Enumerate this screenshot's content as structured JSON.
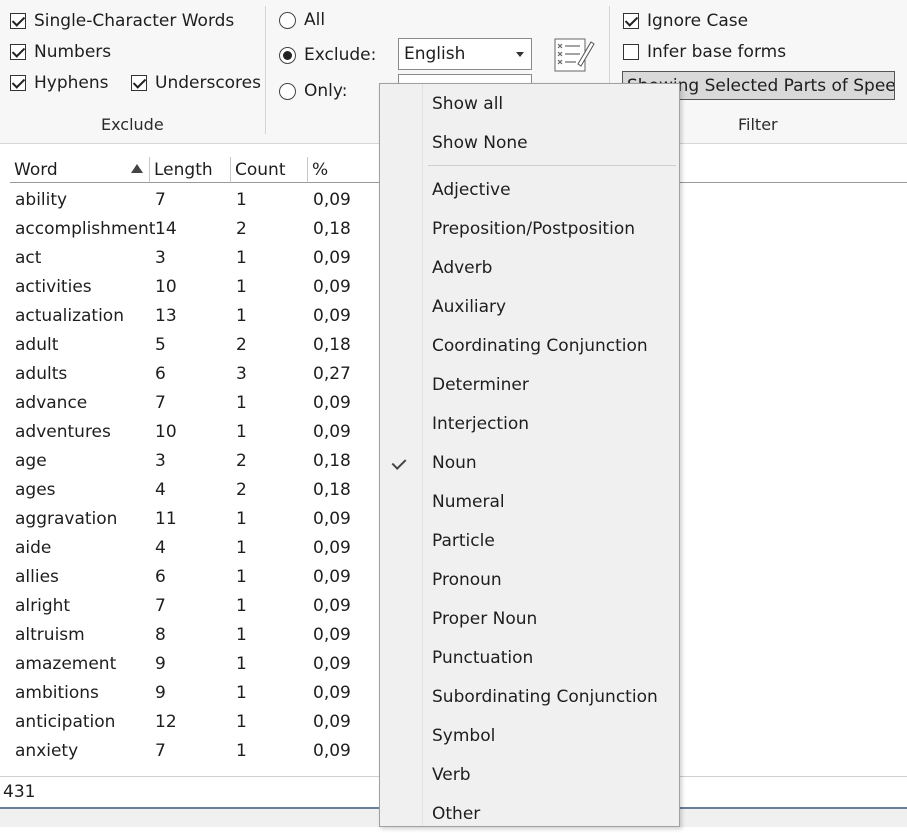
{
  "ribbon": {
    "exclude_group": {
      "label": "Exclude",
      "single_char": {
        "label": "Single-Character Words",
        "checked": true
      },
      "numbers": {
        "label": "Numbers",
        "checked": true
      },
      "hyphens": {
        "label": "Hyphens",
        "checked": true
      },
      "underscores": {
        "label": "Underscores",
        "checked": true
      }
    },
    "stopwords": {
      "all": {
        "label": "All",
        "selected": false
      },
      "exclude": {
        "label": "Exclude:",
        "selected": true
      },
      "only": {
        "label": "Only:",
        "selected": false
      },
      "language_value": "English"
    },
    "filter_group": {
      "label": "Filter",
      "ignore_case": {
        "label": "Ignore Case",
        "checked": true
      },
      "infer_base": {
        "label": "Infer base forms",
        "checked": false
      },
      "pos_button_label": "Showing Selected Parts of Speech"
    }
  },
  "table": {
    "headers": {
      "word": "Word",
      "length": "Length",
      "count": "Count",
      "percent": "%"
    },
    "rows": [
      {
        "word": "ability",
        "length": "7",
        "count": "1",
        "percent": "0,09"
      },
      {
        "word": "accomplishment",
        "length": "14",
        "count": "2",
        "percent": "0,18"
      },
      {
        "word": "act",
        "length": "3",
        "count": "1",
        "percent": "0,09"
      },
      {
        "word": "activities",
        "length": "10",
        "count": "1",
        "percent": "0,09"
      },
      {
        "word": "actualization",
        "length": "13",
        "count": "1",
        "percent": "0,09"
      },
      {
        "word": "adult",
        "length": "5",
        "count": "2",
        "percent": "0,18"
      },
      {
        "word": "adults",
        "length": "6",
        "count": "3",
        "percent": "0,27"
      },
      {
        "word": "advance",
        "length": "7",
        "count": "1",
        "percent": "0,09"
      },
      {
        "word": "adventures",
        "length": "10",
        "count": "1",
        "percent": "0,09"
      },
      {
        "word": "age",
        "length": "3",
        "count": "2",
        "percent": "0,18"
      },
      {
        "word": "ages",
        "length": "4",
        "count": "2",
        "percent": "0,18"
      },
      {
        "word": "aggravation",
        "length": "11",
        "count": "1",
        "percent": "0,09"
      },
      {
        "word": "aide",
        "length": "4",
        "count": "1",
        "percent": "0,09"
      },
      {
        "word": "allies",
        "length": "6",
        "count": "1",
        "percent": "0,09"
      },
      {
        "word": "alright",
        "length": "7",
        "count": "1",
        "percent": "0,09"
      },
      {
        "word": "altruism",
        "length": "8",
        "count": "1",
        "percent": "0,09"
      },
      {
        "word": "amazement",
        "length": "9",
        "count": "1",
        "percent": "0,09"
      },
      {
        "word": "ambitions",
        "length": "9",
        "count": "1",
        "percent": "0,09"
      },
      {
        "word": "anticipation",
        "length": "12",
        "count": "1",
        "percent": "0,09"
      },
      {
        "word": "anxiety",
        "length": "7",
        "count": "1",
        "percent": "0,09"
      }
    ]
  },
  "status": {
    "count_text": "431"
  },
  "menu": {
    "show_all": "Show all",
    "show_none": "Show None",
    "items": [
      {
        "label": "Adjective",
        "checked": false
      },
      {
        "label": "Preposition/Postposition",
        "checked": false
      },
      {
        "label": "Adverb",
        "checked": false
      },
      {
        "label": "Auxiliary",
        "checked": false
      },
      {
        "label": "Coordinating Conjunction",
        "checked": false
      },
      {
        "label": "Determiner",
        "checked": false
      },
      {
        "label": "Interjection",
        "checked": false
      },
      {
        "label": "Noun",
        "checked": true
      },
      {
        "label": "Numeral",
        "checked": false
      },
      {
        "label": "Particle",
        "checked": false
      },
      {
        "label": "Pronoun",
        "checked": false
      },
      {
        "label": "Proper Noun",
        "checked": false
      },
      {
        "label": "Punctuation",
        "checked": false
      },
      {
        "label": "Subordinating Conjunction",
        "checked": false
      },
      {
        "label": "Symbol",
        "checked": false
      },
      {
        "label": "Verb",
        "checked": false
      },
      {
        "label": "Other",
        "checked": false
      }
    ]
  }
}
